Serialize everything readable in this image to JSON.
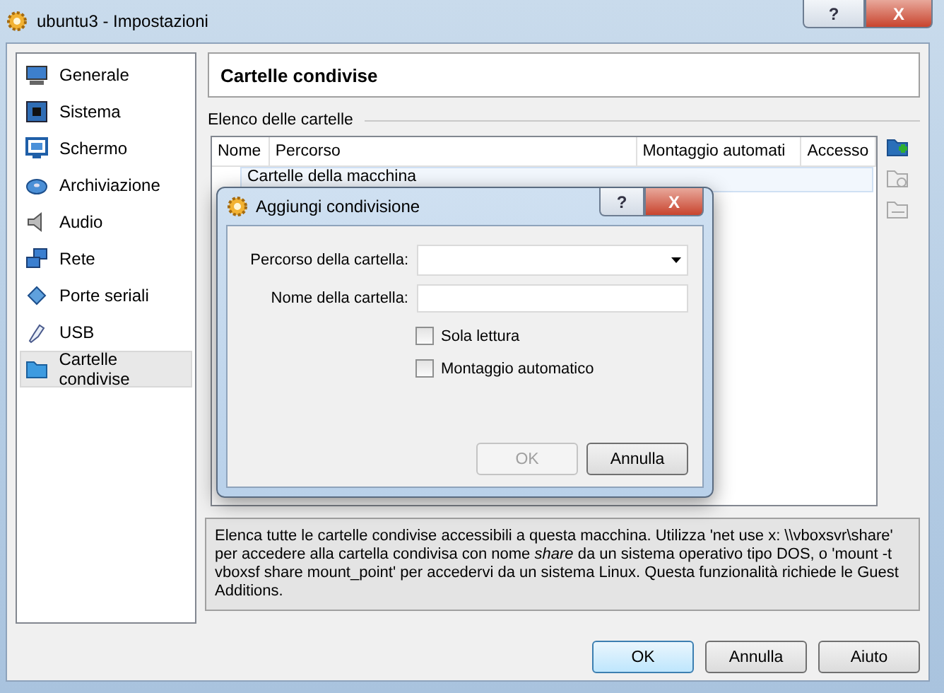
{
  "window": {
    "title": "ubuntu3 - Impostazioni",
    "help_button": "?",
    "close_button": "X"
  },
  "sidebar": {
    "items": [
      {
        "label": "Generale",
        "kind": "monitor",
        "selected": false
      },
      {
        "label": "Sistema",
        "kind": "chip",
        "selected": false
      },
      {
        "label": "Schermo",
        "kind": "screen",
        "selected": false
      },
      {
        "label": "Archiviazione",
        "kind": "disk",
        "selected": false
      },
      {
        "label": "Audio",
        "kind": "speaker",
        "selected": false
      },
      {
        "label": "Rete",
        "kind": "network",
        "selected": false
      },
      {
        "label": "Porte seriali",
        "kind": "serial",
        "selected": false
      },
      {
        "label": "USB",
        "kind": "usb",
        "selected": false
      },
      {
        "label": "Cartelle condivise",
        "kind": "folder",
        "selected": true
      }
    ]
  },
  "page_title": "Cartelle condivise",
  "folders": {
    "label": "Elenco delle cartelle",
    "columns": [
      "Nome",
      "Percorso",
      "Montaggio automati",
      "Accesso"
    ],
    "group_row": "Cartelle della macchina",
    "tools": [
      {
        "kind": "add",
        "disabled": false
      },
      {
        "kind": "edit",
        "disabled": true
      },
      {
        "kind": "remove",
        "disabled": true
      }
    ]
  },
  "info": "Elenca tutte le cartelle condivise accessibili a questa macchina. Utilizza 'net use x: \\\\vboxsvr\\share' per accedere alla cartella condivisa con nome *share* da un sistema operativo tipo DOS, o 'mount -t vboxsf share mount_point' per accedervi da un sistema Linux. Questa funzionalità richiede le Guest Additions.",
  "buttons": [
    {
      "label": "OK",
      "default": true
    },
    {
      "label": "Annulla",
      "default": false
    },
    {
      "label": "Aiuto",
      "default": false
    }
  ],
  "dialog": {
    "title": "Aggiungi condivisione",
    "help_button": "?",
    "close_button": "X",
    "path_label": "Percorso della cartella:",
    "name_label": "Nome della cartella:",
    "checkboxes": [
      {
        "label": "Sola lettura",
        "checked": false
      },
      {
        "label": "Montaggio automatico",
        "checked": false
      }
    ],
    "buttons": [
      {
        "label": "OK",
        "disabled": true
      },
      {
        "label": "Annulla",
        "disabled": false
      }
    ]
  }
}
